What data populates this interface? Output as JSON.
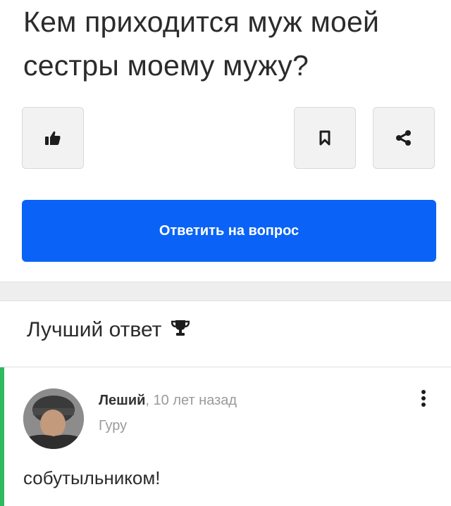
{
  "question": {
    "title_line1": "Кем приходится муж моей",
    "title_line2": "сестры моему мужу?"
  },
  "actions": {
    "like_icon": "thumbs-up-icon",
    "bookmark_icon": "bookmark-icon",
    "share_icon": "share-icon",
    "answer_button_label": "Ответить на вопрос"
  },
  "best_answer": {
    "header": "Лучший ответ",
    "header_icon": "trophy-icon",
    "author_name": "Леший",
    "time_ago": ", 10 лет назад",
    "author_rank": "Гуру",
    "text": "собутыльником!",
    "menu_icon": "more-vertical-icon"
  },
  "colors": {
    "accent_blue": "#0a63f6",
    "best_answer_green": "#2dbb5e"
  }
}
